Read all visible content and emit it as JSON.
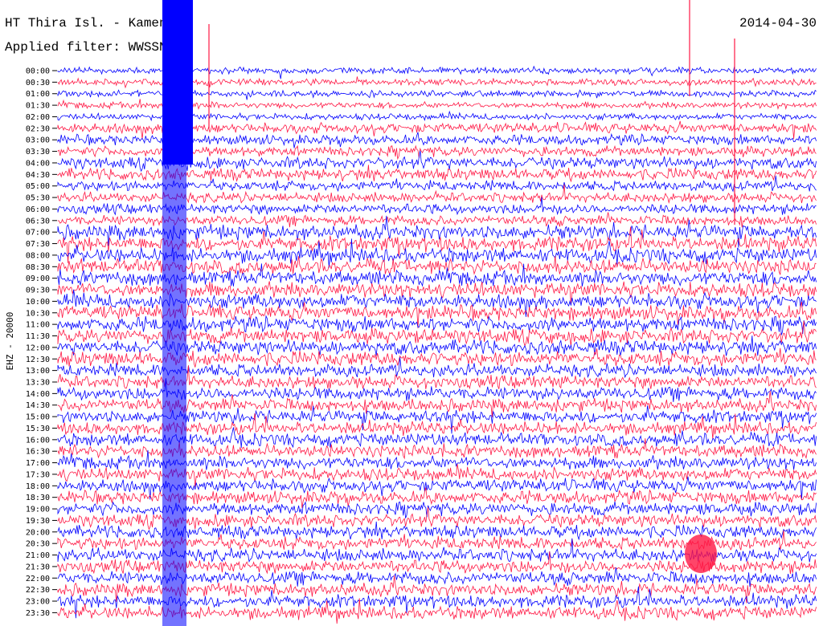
{
  "header": {
    "title": "HT Thira Isl. - Kameni",
    "filter": "Applied filter: WWSSN-S",
    "date": "2014-04-30"
  },
  "chart_data": {
    "type": "line",
    "ylabel": "EHZ - 20000",
    "tick_labels": [
      "00:00",
      "00:30",
      "01:00",
      "01:30",
      "02:00",
      "02:30",
      "03:00",
      "03:30",
      "04:00",
      "04:30",
      "05:00",
      "05:30",
      "06:00",
      "06:30",
      "07:00",
      "07:30",
      "08:00",
      "08:30",
      "09:00",
      "09:30",
      "10:00",
      "10:30",
      "11:00",
      "11:30",
      "12:00",
      "12:30",
      "13:00",
      "13:30",
      "14:00",
      "14:30",
      "15:00",
      "15:30",
      "16:00",
      "16:30",
      "17:00",
      "17:30",
      "18:00",
      "18:30",
      "19:00",
      "19:30",
      "20:00",
      "20:30",
      "21:00",
      "21:30",
      "22:00",
      "22:30",
      "23:00",
      "23:30"
    ],
    "series_colors": [
      "#0000ff",
      "#ff1744"
    ],
    "grid": false
  }
}
